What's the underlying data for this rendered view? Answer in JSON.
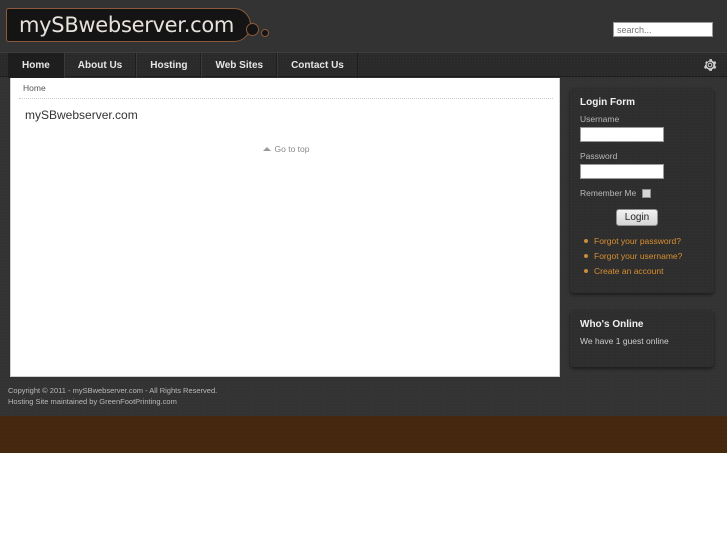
{
  "site": {
    "logo_text": "mySBwebserver.com",
    "colors": {
      "header_bg": "#333333",
      "navbar_bg": "#2a2a2a",
      "accent_brown": "#46280f",
      "link_orange": "#d88f2f",
      "module_bg": "#2e2e2e"
    }
  },
  "search": {
    "placeholder": "search...",
    "value": ""
  },
  "nav": {
    "items": [
      {
        "label": "Home",
        "active": true
      },
      {
        "label": "About Us",
        "active": false
      },
      {
        "label": "Hosting",
        "active": false
      },
      {
        "label": "Web Sites",
        "active": false
      },
      {
        "label": "Contact Us",
        "active": false
      }
    ],
    "gear_icon": "gear-icon"
  },
  "content": {
    "breadcrumb": "Home",
    "page_title": "mySBwebserver.com",
    "go_to_top": "Go to top"
  },
  "login_module": {
    "title": "Login Form",
    "username_label": "Username",
    "username_value": "",
    "password_label": "Password",
    "password_value": "",
    "remember_label": "Remember Me",
    "remember_checked": false,
    "login_button": "Login",
    "links": [
      "Forgot your password?",
      "Forgot your username?",
      "Create an account"
    ]
  },
  "online_module": {
    "title": "Who's Online",
    "text": "We have 1 guest online"
  },
  "footer": {
    "line1": "Copyright © 2011 - mySBwebserver.com - All Rights Reserved.",
    "line2": "Hosting Site maintained by GreenFootPrinting.com"
  }
}
